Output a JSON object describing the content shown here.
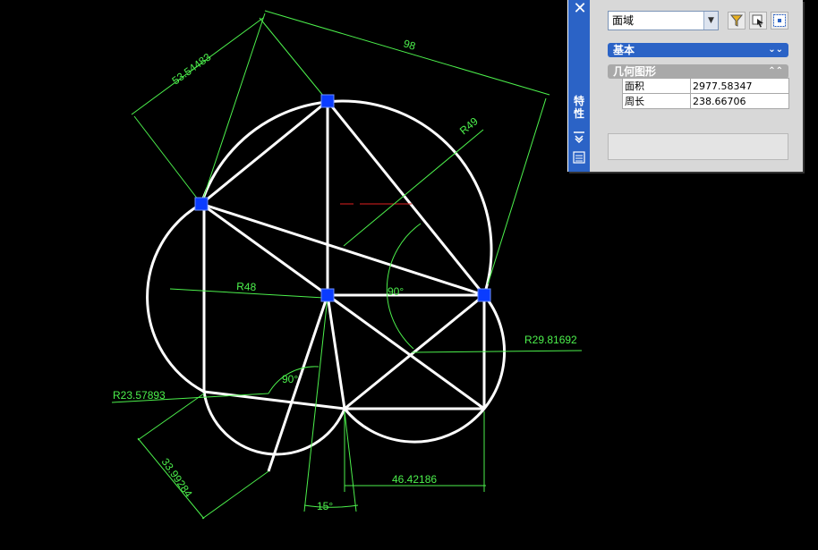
{
  "drawing": {
    "dimensions": {
      "d1": "53.54483",
      "d2": "98",
      "d3": "R49",
      "d4": "R48",
      "d5": "90°",
      "d6": "R29.81692",
      "d7": "R23.57893",
      "d8": "90°",
      "d9": "33.99284",
      "d10": "46.42186",
      "d11": "15°"
    }
  },
  "properties_palette": {
    "close_icon": "close-icon",
    "vertical_title": "特性",
    "object_type": "面域",
    "toolbar_icons": [
      "quick-select-icon",
      "select-objects-icon",
      "pickadd-toggle-icon"
    ],
    "sections": {
      "basic": {
        "label": "基本",
        "state": "collapsed"
      },
      "geometry": {
        "label": "几何图形",
        "state": "expanded"
      }
    },
    "geometry_rows": [
      {
        "key": "面积",
        "value": "2977.58347"
      },
      {
        "key": "周长",
        "value": "238.66706"
      }
    ]
  },
  "colors": {
    "canvas": "#000000",
    "geometry": "#ffffff",
    "dimension": "#4cf04c",
    "grip": "#0a3cff",
    "palette_accent": "#2b63c6"
  }
}
